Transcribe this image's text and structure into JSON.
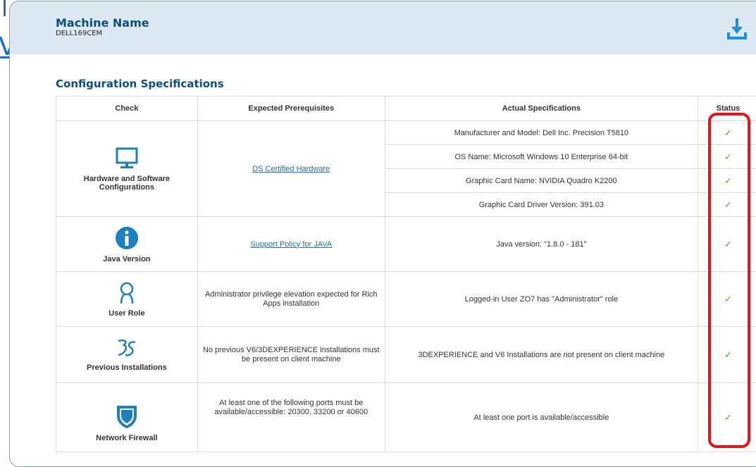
{
  "background_fragments": {
    "frag1": "ıl",
    "frag2": "V"
  },
  "header": {
    "machine_label": "Machine Name",
    "machine_value": "DELL169CEM",
    "download_icon": "download-icon"
  },
  "section_title": "Configuration Specifications",
  "table": {
    "headers": [
      "Check",
      "Expected Prerequisites",
      "Actual Specifications",
      "Status"
    ],
    "rows": [
      {
        "check": "Hardware and Software Configurations",
        "icon": "monitor-icon",
        "expected": "DS Certified Hardware",
        "actual": [
          "Manufacturer and Model: Dell Inc. Precision T5810",
          "OS Name: Microsoft Windows 10 Enterprise 64-bit",
          "Graphic Card Name: NVIDIA Quadro K2200",
          "Graphic Card Driver Version: 391.03"
        ],
        "status": [
          "✓",
          "✓",
          "✓",
          "✓"
        ]
      },
      {
        "check": "Java Version",
        "icon": "info-icon",
        "expected": "Support Policy for JAVA",
        "actual": [
          "Java version: \"1.8.0 - 181\""
        ],
        "status": [
          "✓"
        ]
      },
      {
        "check": "User Role",
        "icon": "user-icon",
        "expected": "Administrator privilege elevation expected for Rich Apps installation",
        "actual": [
          "Logged-in User ZO7 has \"Administrator\" role"
        ],
        "status": [
          "✓"
        ]
      },
      {
        "check": "Previous Installations",
        "icon": "3ds-logo-icon",
        "expected": "No previous V6/3DEXPERIENCE installations must be present on client machine",
        "actual": [
          "3DEXPERIENCE and V6 Installations are not present on client machine"
        ],
        "status": [
          "✓"
        ]
      },
      {
        "check": "Network Firewall",
        "icon": "shield-icon",
        "expected": "At least one of the following ports must be available/accessible: 20300, 33200 or 40600",
        "actual": [
          "At least one port is available/accessible"
        ],
        "status": [
          "✓"
        ]
      }
    ]
  },
  "colors": {
    "accent": "#0b4f7e",
    "header_bg": "#dce9f2",
    "check_green": "#5aa641",
    "highlight_red": "#e8131a",
    "link": "#1c6fb8"
  }
}
